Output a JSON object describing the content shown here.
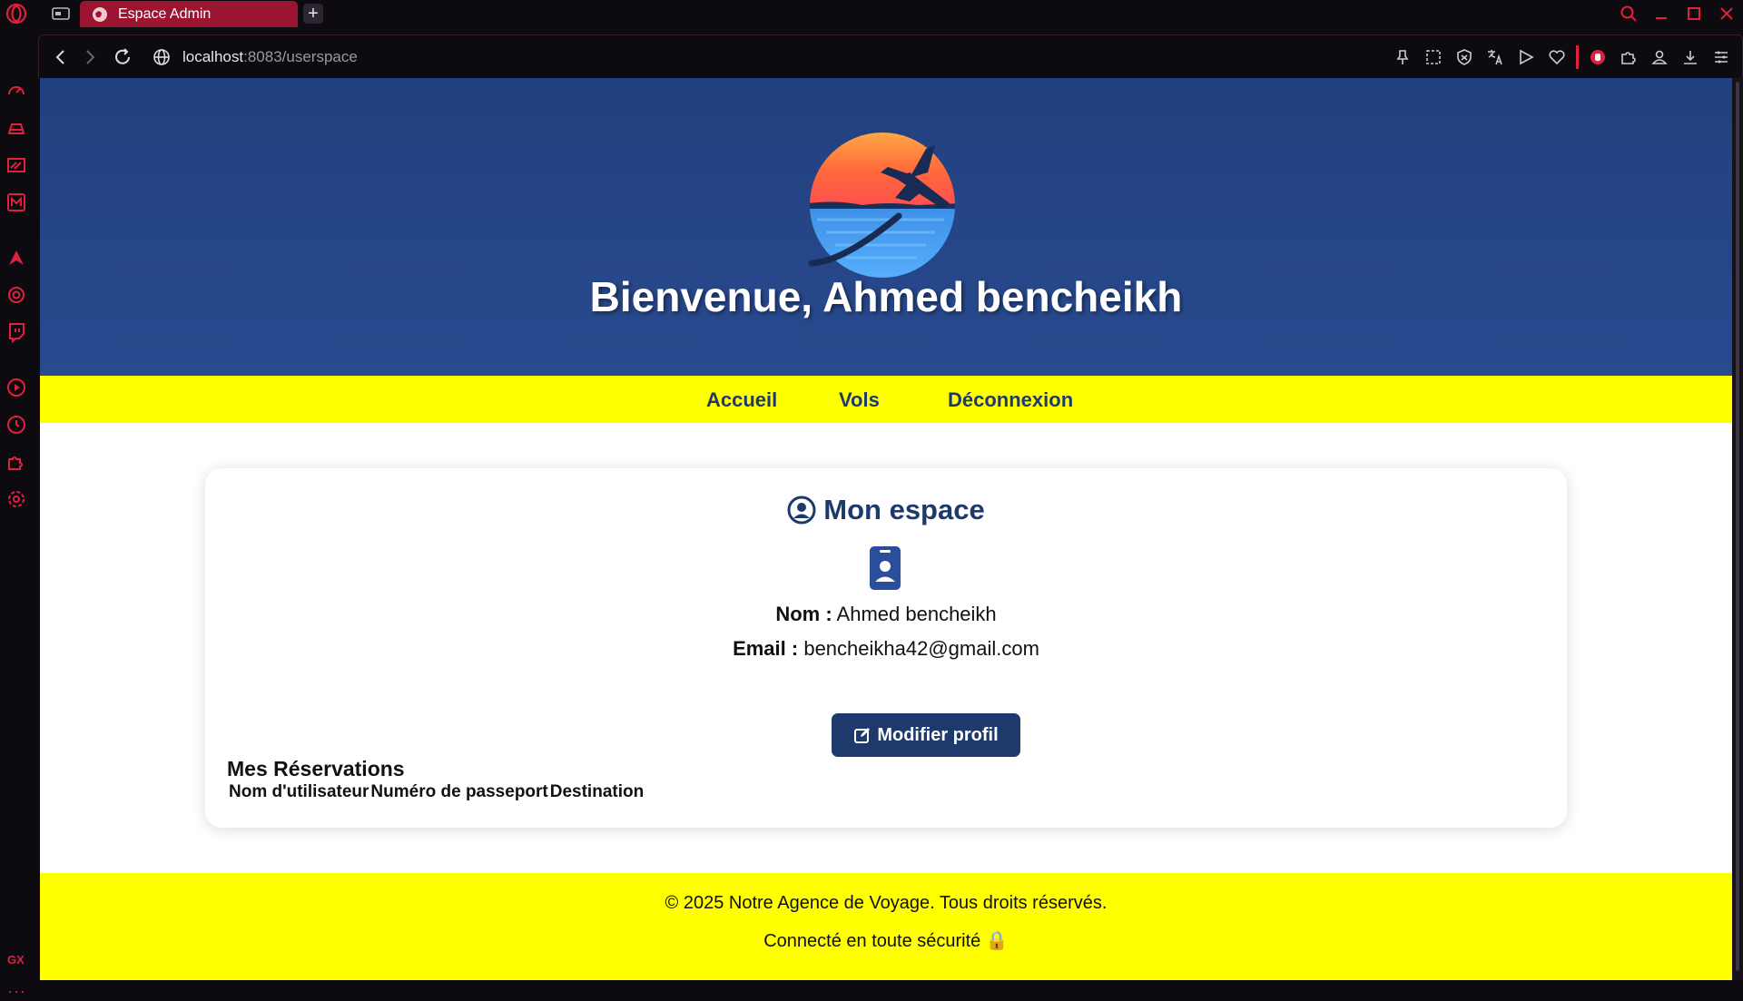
{
  "browser": {
    "tab_title": "Espace Admin",
    "new_tab_symbol": "+",
    "url_host": "localhost",
    "url_path": ":8083/userspace",
    "sidebar_gx_label": "GX",
    "sidebar_more_label": "···",
    "accent_color": "#e0203d",
    "tab_color": "#9b1430"
  },
  "page": {
    "welcome_title": "Bienvenue, Ahmed bencheikh",
    "nav": {
      "home": "Accueil",
      "flights": "Vols",
      "logout": "Déconnexion"
    },
    "card": {
      "title": "Mon espace",
      "name_label": "Nom :",
      "name_value": "Ahmed bencheikh",
      "email_label": "Email :",
      "email_value": "bencheikha42@gmail.com",
      "edit_button": "Modifier profil",
      "reservations_title": "Mes Réservations",
      "reservations_columns": [
        "Nom d'utilisateur",
        "Numéro de passeport",
        "Destination"
      ]
    },
    "footer": {
      "copyright": "© 2025 Notre Agence de Voyage. Tous droits réservés.",
      "secure": "Connecté en toute sécurité 🔒"
    },
    "colors": {
      "hero": "#244688",
      "nav_yellow": "#ffff00",
      "primary_blue": "#1e3a6d"
    }
  }
}
